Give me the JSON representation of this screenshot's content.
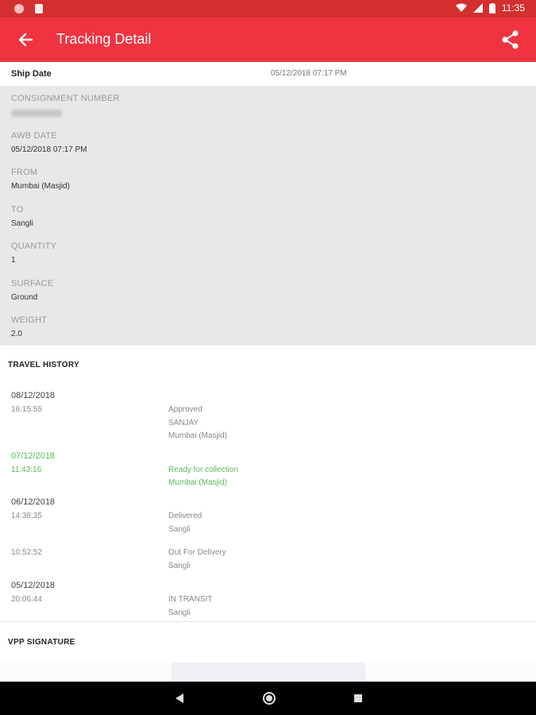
{
  "status_bar": {
    "time": "11:35"
  },
  "app_bar": {
    "title": "Tracking Detail"
  },
  "ship": {
    "label": "Ship Date",
    "value": "05/12/2018 07:17 PM"
  },
  "details": {
    "consignment": {
      "label": "CONSIGNMENT NUMBER"
    },
    "awb_date": {
      "label": "AWB DATE",
      "value": "05/12/2018 07:17 PM"
    },
    "from": {
      "label": "FROM",
      "value": "Mumbai (Masjid)"
    },
    "to": {
      "label": "TO",
      "value": "Sangli"
    },
    "quantity": {
      "label": "QUANTITY",
      "value": "1"
    },
    "surface": {
      "label": "SURFACE",
      "value": "Ground"
    },
    "weight": {
      "label": "WEIGHT",
      "value": "2.0"
    }
  },
  "travel_history": {
    "title": "TRAVEL HISTORY",
    "entries": [
      {
        "date": "08/12/2018",
        "time": "16:15:55",
        "status": "Approved",
        "person": "SANJAY",
        "location": "Mumbai (Masjid)"
      },
      {
        "date": "07/12/2018",
        "time": "11:43:16",
        "status": "Ready for collection",
        "location": "Mumbai (Masjid)"
      },
      {
        "date": "06/12/2018",
        "time": "14:38:35",
        "status": "Delivered",
        "location": "Sangli"
      },
      {
        "time": "10:52:52",
        "status": "Out For Delivery",
        "location": "Sangli"
      },
      {
        "date": "05/12/2018",
        "time": "20:06:44",
        "status": "IN TRANSIT",
        "location": "Sangli"
      }
    ]
  },
  "vpp": {
    "title": "VPP SIGNATURE"
  },
  "colors": {
    "app_bar": "#ef3340",
    "status_bar": "#d32f2f",
    "highlight": "#5cb85c",
    "details_bg": "#e8e8e8"
  }
}
